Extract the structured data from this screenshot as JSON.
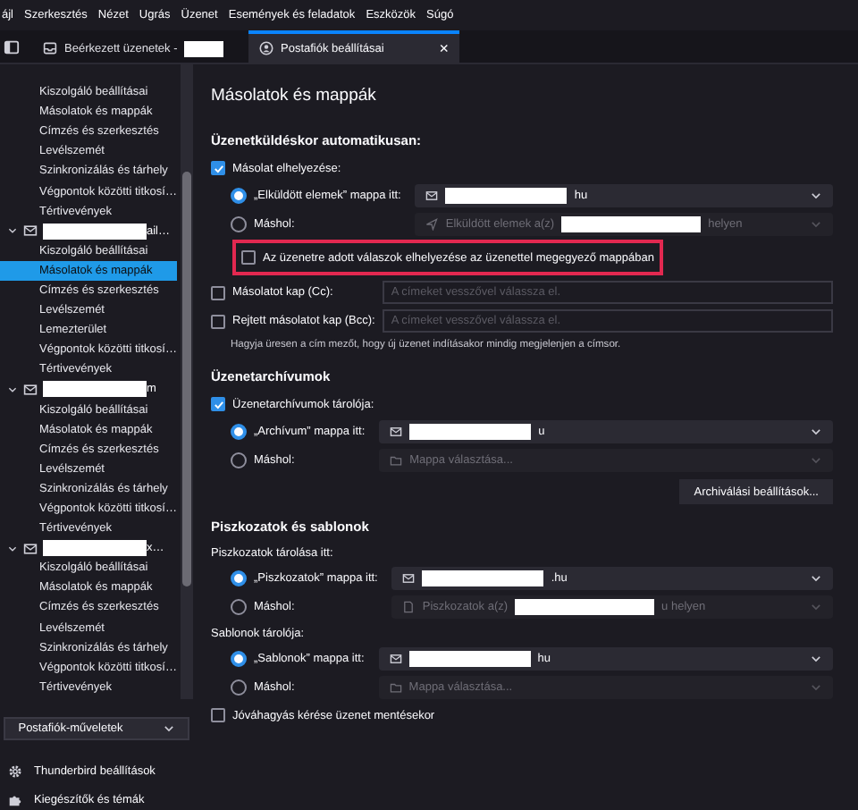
{
  "menubar": [
    "ájl",
    "Szerkesztés",
    "Nézet",
    "Ugrás",
    "Üzenet",
    "Események és feladatok",
    "Eszközök",
    "Súgó"
  ],
  "tabs": [
    {
      "label": "Beérkezett üzenetek -",
      "redacted": true,
      "selected": false,
      "kind": "inbox"
    },
    {
      "label": "Postafiók beállításai",
      "selected": true,
      "kind": "account",
      "close": "×"
    }
  ],
  "sidebar": {
    "accounts": [
      {
        "children": [
          {
            "label": "Kiszolgáló beállításai",
            "selected": false
          },
          {
            "label": "Másolatok és mappák",
            "selected": false
          },
          {
            "label": "Címzés és szerkesztés",
            "selected": false
          },
          {
            "label": "Levélszemét",
            "selected": false
          },
          {
            "label": "Szinkronizálás és tárhely",
            "selected": false
          },
          {
            "label": "Végpontok közötti titkosí…",
            "selected": false
          },
          {
            "label": "Tértivevények",
            "selected": false
          }
        ]
      },
      {
        "name_end": "ail…",
        "expanded": true,
        "children": [
          {
            "label": "Kiszolgáló beállításai",
            "selected": false
          },
          {
            "label": "Másolatok és mappák",
            "selected": true
          },
          {
            "label": "Címzés és szerkesztés",
            "selected": false
          },
          {
            "label": "Levélszemét",
            "selected": false
          },
          {
            "label": "Lemezterület",
            "selected": false
          },
          {
            "label": "Végpontok közötti titkosí…",
            "selected": false
          },
          {
            "label": "Tértivevények",
            "selected": false
          }
        ]
      },
      {
        "name_end": "m",
        "expanded": true,
        "children": [
          {
            "label": "Kiszolgáló beállításai",
            "selected": false
          },
          {
            "label": "Másolatok és mappák",
            "selected": false
          },
          {
            "label": "Címzés és szerkesztés",
            "selected": false
          },
          {
            "label": "Levélszemét",
            "selected": false
          },
          {
            "label": "Szinkronizálás és tárhely",
            "selected": false
          },
          {
            "label": "Végpontok közötti titkosí…",
            "selected": false
          },
          {
            "label": "Tértivevények",
            "selected": false
          }
        ]
      },
      {
        "name_end": "x…",
        "expanded": true,
        "children": [
          {
            "label": "Kiszolgáló beállításai",
            "selected": false
          },
          {
            "label": "Másolatok és mappák",
            "selected": false
          },
          {
            "label": "Címzés és szerkesztés",
            "selected": false
          },
          {
            "label": "Levélszemét",
            "selected": false
          },
          {
            "label": "Szinkronizálás és tárhely",
            "selected": false
          },
          {
            "label": "Végpontok közötti titkosí…",
            "selected": false
          },
          {
            "label": "Tértivevények",
            "selected": false
          }
        ]
      }
    ],
    "actions_button": "Postafiók-műveletek",
    "footer": [
      {
        "label": "Thunderbird beállítások",
        "kind": "gear"
      },
      {
        "label": "Kiegészítők és témák",
        "kind": "puzzle"
      }
    ]
  },
  "page_title": "Másolatok és mappák",
  "sections": [
    {
      "heading": "Üzenetküldéskor automatikusan:",
      "rows": [
        {
          "kind": "checkbox",
          "label": "Másolat elhelyezése:",
          "checked": true
        },
        {
          "kind": "radio",
          "label": "„Elküldött elemek” mappa itt:",
          "selected": true,
          "select": {
            "kind": "account",
            "redacted": true,
            "after": "hu",
            "disabled": false
          }
        },
        {
          "kind": "radio",
          "label": "Máshol:",
          "selected": false,
          "select": {
            "kind": "sent",
            "before": "Elküldött elemek a(z)",
            "redacted": true,
            "after": "helyen",
            "disabled": true
          }
        },
        {
          "kind": "checkbox",
          "label": "Az üzenetre adott válaszok elhelyezése az üzenettel megegyező mappában",
          "checked": false,
          "highlighted": true
        },
        {
          "kind": "field",
          "label": "Másolatot kap (Cc):",
          "checked": false,
          "placeholder": "A címeket vesszővel válassza el."
        },
        {
          "kind": "field",
          "label": "Rejtett másolatot kap (Bcc):",
          "checked": false,
          "placeholder": "A címeket vesszővel válassza el."
        },
        {
          "kind": "hint",
          "text": "Hagyja üresen a cím mezőt, hogy új üzenet indításakor mindig megjelenjen a címsor."
        }
      ]
    },
    {
      "heading": "Üzenetarchívumok",
      "rows": [
        {
          "kind": "checkbox",
          "label": "Üzenetarchívumok tárolója:",
          "checked": true
        },
        {
          "kind": "radio",
          "label": "„Archívum” mappa itt:",
          "selected": true,
          "select": {
            "kind": "account",
            "redacted": true,
            "after": "u",
            "disabled": false
          }
        },
        {
          "kind": "radio",
          "label": "Máshol:",
          "selected": false,
          "select": {
            "kind": "folder",
            "before": "Mappa választása...",
            "disabled": true
          }
        },
        {
          "kind": "button",
          "label": "Archiválási beállítások..."
        }
      ]
    },
    {
      "heading": "Piszkozatok és sablonok",
      "rows": [
        {
          "kind": "label",
          "text": "Piszkozatok tárolása itt:"
        },
        {
          "kind": "radio",
          "label": "„Piszkozatok” mappa itt:",
          "selected": true,
          "select": {
            "kind": "account",
            "redacted": true,
            "after": ".hu",
            "disabled": false
          }
        },
        {
          "kind": "radio",
          "label": "Máshol:",
          "selected": false,
          "select": {
            "kind": "drafts",
            "before": "Piszkozatok a(z)",
            "redacted": true,
            "after": "u helyen",
            "disabled": true
          }
        },
        {
          "kind": "label",
          "text": "Sablonok tárolója:"
        },
        {
          "kind": "radio",
          "label": "„Sablonok” mappa itt:",
          "selected": true,
          "select": {
            "kind": "account",
            "redacted": true,
            "after": "hu",
            "disabled": false
          }
        },
        {
          "kind": "radio",
          "label": "Máshol:",
          "selected": false,
          "select": {
            "kind": "folder",
            "before": "Mappa választása...",
            "disabled": true
          }
        },
        {
          "kind": "checkbox",
          "label": "Jóváhagyás kérése üzenet mentésekor",
          "checked": false
        }
      ]
    }
  ]
}
